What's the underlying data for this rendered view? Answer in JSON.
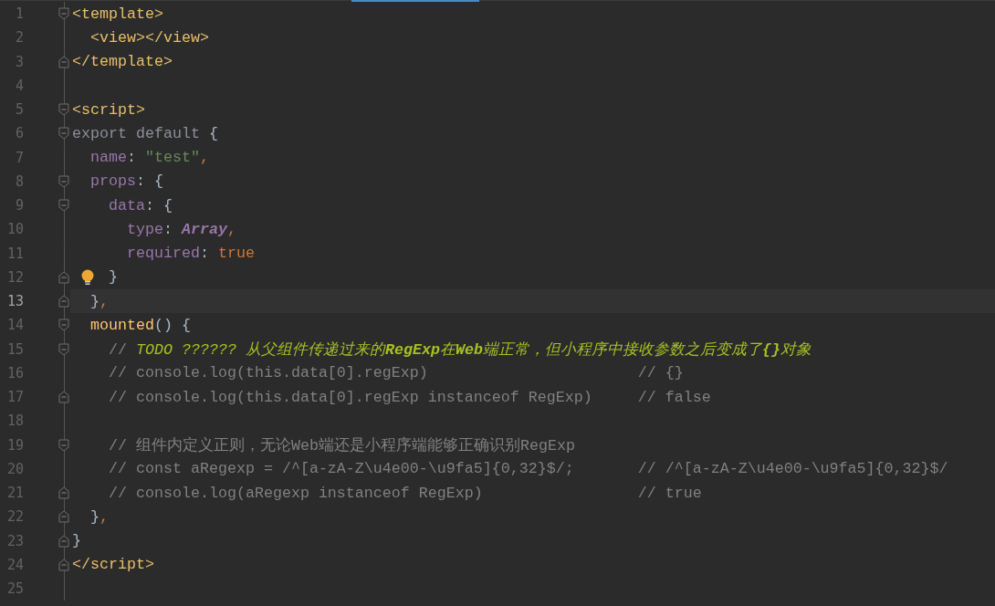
{
  "editor": {
    "lines": [
      {
        "number": "1",
        "fold_open": true,
        "current": false,
        "tokens": [
          {
            "kind": "tag",
            "text": "<template>"
          }
        ]
      },
      {
        "number": "2",
        "current": false,
        "tokens": [
          {
            "kind": "tag",
            "text": "  <view></view>"
          }
        ]
      },
      {
        "number": "3",
        "fold_close": true,
        "current": false,
        "tokens": [
          {
            "kind": "tag",
            "text": "</template>"
          }
        ]
      },
      {
        "number": "4",
        "current": false
      },
      {
        "number": "5",
        "fold_open": true,
        "current": false,
        "tokens": [
          {
            "kind": "tag",
            "text": "<script>"
          }
        ]
      },
      {
        "number": "6",
        "fold_open": true,
        "current": false,
        "tokens": [
          {
            "kind": "dim",
            "text": "export default "
          },
          {
            "kind": "plain",
            "text": "{"
          }
        ]
      },
      {
        "number": "7",
        "current": false,
        "tokens": [
          {
            "kind": "prop",
            "text": "  name"
          },
          {
            "kind": "plain",
            "text": ": "
          },
          {
            "kind": "string",
            "text": "\"test\""
          },
          {
            "kind": "literal",
            "text": ","
          }
        ]
      },
      {
        "number": "8",
        "fold_open": true,
        "current": false,
        "tokens": [
          {
            "kind": "prop",
            "text": "  props"
          },
          {
            "kind": "plain",
            "text": ": {"
          }
        ]
      },
      {
        "number": "9",
        "fold_open": true,
        "current": false,
        "tokens": [
          {
            "kind": "prop",
            "text": "    data"
          },
          {
            "kind": "plain",
            "text": ": {"
          }
        ]
      },
      {
        "number": "10",
        "current": false,
        "tokens": [
          {
            "kind": "prop",
            "text": "      type"
          },
          {
            "kind": "plain",
            "text": ": "
          },
          {
            "kind": "type",
            "text": "Array"
          },
          {
            "kind": "literal",
            "text": ","
          }
        ]
      },
      {
        "number": "11",
        "current": false,
        "tokens": [
          {
            "kind": "prop",
            "text": "      required"
          },
          {
            "kind": "plain",
            "text": ": "
          },
          {
            "kind": "literal",
            "text": "true"
          }
        ]
      },
      {
        "number": "12",
        "fold_close": true,
        "bulb": true,
        "current": false,
        "tokens": [
          {
            "kind": "plain",
            "text": "    }"
          }
        ]
      },
      {
        "number": "13",
        "fold_close": true,
        "current": true,
        "tokens": [
          {
            "kind": "plain",
            "text": "  }"
          },
          {
            "kind": "literal",
            "text": ","
          }
        ]
      },
      {
        "number": "14",
        "fold_open": true,
        "current": false,
        "tokens": [
          {
            "kind": "func",
            "text": "  mounted"
          },
          {
            "kind": "plain",
            "text": "() {"
          }
        ]
      },
      {
        "number": "15",
        "fold_open": true,
        "current": false,
        "tokens": [
          {
            "kind": "comment",
            "text": "    // "
          },
          {
            "kind": "todo",
            "text": "TODO ?????? 从父组件传递过来的**RegExp**在**Web**端正常，但小程序中接收参数之后变成了**{}**对象"
          }
        ]
      },
      {
        "number": "16",
        "current": false,
        "tokens": [
          {
            "kind": "comment",
            "text": "    // console.log(this.data[0].regExp)                       // {}"
          }
        ]
      },
      {
        "number": "17",
        "fold_close": true,
        "current": false,
        "tokens": [
          {
            "kind": "comment",
            "text": "    // console.log(this.data[0].regExp instanceof RegExp)     // false"
          }
        ]
      },
      {
        "number": "18",
        "current": false
      },
      {
        "number": "19",
        "fold_open": true,
        "current": false,
        "tokens": [
          {
            "kind": "comment",
            "text": "    // 组件内定义正则，无论Web端还是小程序端能够正确识别RegExp"
          }
        ]
      },
      {
        "number": "20",
        "current": false,
        "tokens": [
          {
            "kind": "comment",
            "text": "    // const aRegexp = /^[a-zA-Z\\u4e00-\\u9fa5]{0,32}$/;       // /^[a-zA-Z\\u4e00-\\u9fa5]{0,32}$/"
          }
        ]
      },
      {
        "number": "21",
        "fold_close": true,
        "current": false,
        "tokens": [
          {
            "kind": "comment",
            "text": "    // console.log(aRegexp instanceof RegExp)                 // true"
          }
        ]
      },
      {
        "number": "22",
        "fold_close": true,
        "current": false,
        "tokens": [
          {
            "kind": "plain",
            "text": "  }"
          },
          {
            "kind": "literal",
            "text": ","
          }
        ]
      },
      {
        "number": "23",
        "fold_close": true,
        "current": false,
        "tokens": [
          {
            "kind": "plain",
            "text": "}"
          }
        ]
      },
      {
        "number": "24",
        "fold_close": true,
        "current": false,
        "tokens": [
          {
            "kind": "tag",
            "text": "</script>"
          }
        ]
      },
      {
        "number": "25",
        "current": false
      }
    ]
  }
}
